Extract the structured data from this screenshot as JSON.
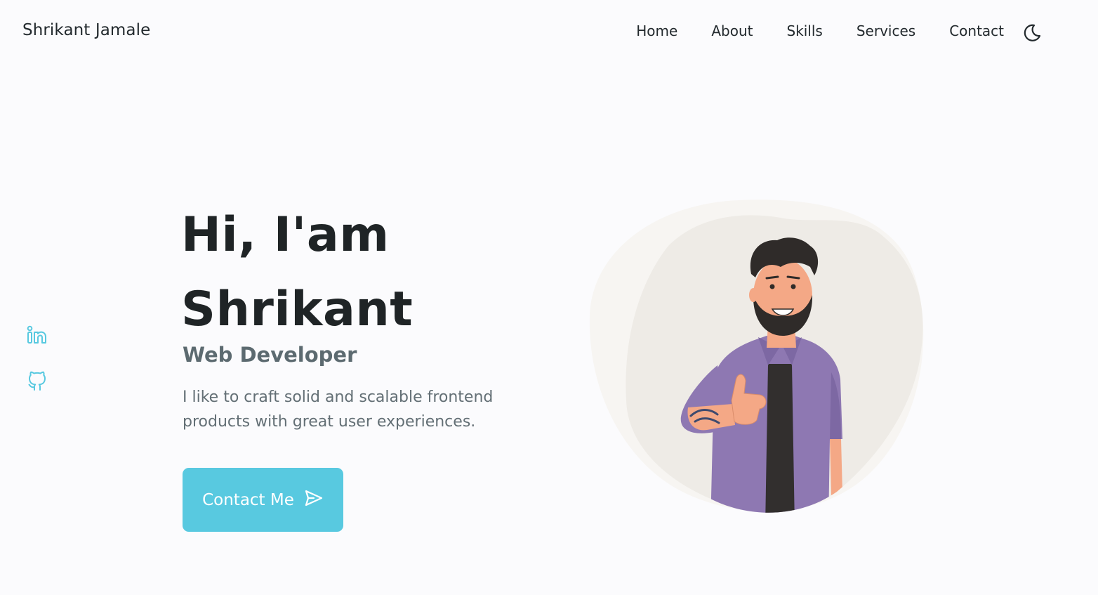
{
  "header": {
    "logo": "Shrikant Jamale",
    "nav": [
      "Home",
      "About",
      "Skills",
      "Services",
      "Contact"
    ],
    "theme_toggle_icon": "moon-icon"
  },
  "socials": [
    {
      "icon": "linkedin-icon"
    },
    {
      "icon": "github-icon"
    }
  ],
  "hero": {
    "greeting_line1": "Hi, I'am",
    "greeting_line2": "Shrikant",
    "role": "Web Developer",
    "description": "I like to craft solid and scalable frontend products with great user experiences.",
    "cta_label": "Contact Me",
    "cta_icon": "send-icon"
  },
  "colors": {
    "accent": "#58c9e0",
    "background": "#fbfbfd",
    "text": "#1f2426",
    "muted": "#636f75"
  }
}
